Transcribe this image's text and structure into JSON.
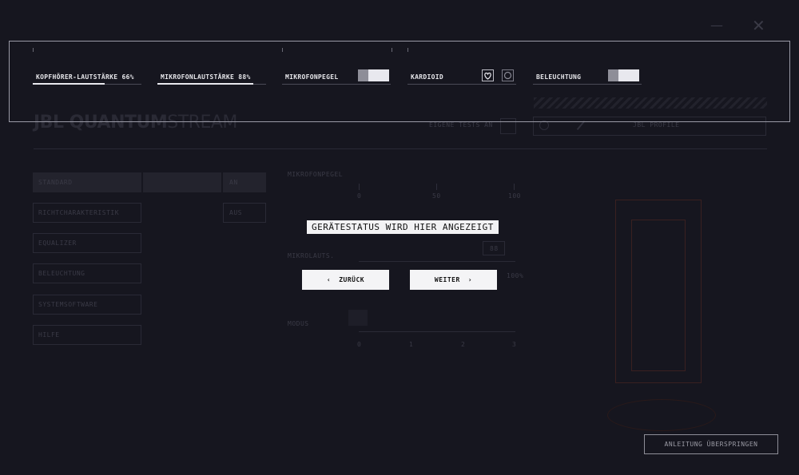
{
  "background_app": {
    "window_controls": {
      "minimize": "—",
      "close": "✕"
    },
    "logo": {
      "jbl": "JBL",
      "quantum": "QUANTUM",
      "stream": "STREAM"
    },
    "header": {
      "mic_test_label": "EIGENE TESTS AN",
      "profile_label": "JBL PROFILE"
    },
    "sidebar": {
      "items": [
        "STANDARD",
        "RICHTCHARAKTERISTIK",
        "EQUALIZER",
        "BELEUCHTUNG",
        "SYSTEMSOFTWARE",
        "HILFE"
      ],
      "active_value": "AN",
      "secondary_value": "AUS"
    },
    "sections": {
      "mic_level": "MIKROFONPEGEL",
      "scale_0": "0",
      "scale_50": "50",
      "scale_100": "100",
      "volume": "MIKROLAUTS.",
      "volume_value": "88",
      "volume_max": "100%",
      "pattern": "MODUS",
      "pattern_scale": [
        "0",
        "1",
        "2",
        "3"
      ]
    }
  },
  "overlay_controls": {
    "headphone_volume": {
      "label": "KOPFHÖRER-LAUTSTÄRKE 66%",
      "value": 0.66
    },
    "mic_volume": {
      "label": "MIKROFONLAUTSTÄRKE 88%",
      "value": 0.88
    },
    "mic_monitor": {
      "label": "MIKROFONPEGEL",
      "on": true
    },
    "cardioid": {
      "label": "KARDIOID",
      "icons": [
        "cardioid-pattern-icon",
        "omni-pattern-icon"
      ]
    },
    "lighting": {
      "label": "BELEUCHTUNG",
      "on": true
    }
  },
  "dialog": {
    "status_text": "GERÄTESTATUS WIRD HIER ANGEZEIGT",
    "back_label": "ZURÜCK",
    "next_label": "WEITER",
    "back_icon": "chevron-left-icon",
    "next_icon": "chevron-right-icon"
  },
  "skip_label": "ANLEITUNG ÜBERSPRINGEN",
  "colors": {
    "background": "#16161f",
    "panel_border": "#9a9aa6",
    "button_bg": "#f4f4f6"
  }
}
